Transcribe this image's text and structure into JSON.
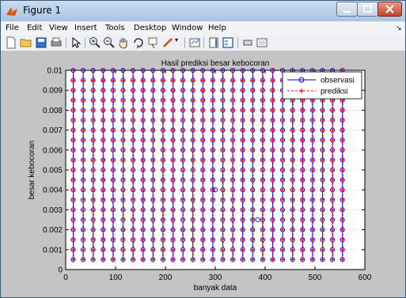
{
  "window": {
    "title": "Figure 1",
    "menu": [
      "File",
      "Edit",
      "View",
      "Insert",
      "Tools",
      "Desktop",
      "Window",
      "Help"
    ],
    "toolbar_icons": [
      "new-file-icon",
      "open-folder-icon",
      "save-icon",
      "print-icon",
      "pointer-icon",
      "zoom-in-icon",
      "zoom-out-icon",
      "pan-hand-icon",
      "rotate-3d-icon",
      "data-cursor-icon",
      "brush-icon",
      "link-plot-icon",
      "colorbar-icon",
      "legend-icon",
      "hide-plot-tools-icon",
      "show-plot-tools-icon"
    ]
  },
  "chart_data": {
    "type": "scatter",
    "title": "Hasil prediksi besar kebocoran",
    "xlabel": "banyak data",
    "ylabel": "besar kebocoran",
    "xlim": [
      0,
      600
    ],
    "ylim": [
      0,
      0.01
    ],
    "xticks": [
      "0",
      "100",
      "200",
      "300",
      "400",
      "500",
      "600"
    ],
    "yticks": [
      "0",
      "0.001",
      "0.002",
      "0.003",
      "0.004",
      "0.005",
      "0.006",
      "0.007",
      "0.008",
      "0.009",
      "0.01"
    ],
    "grid": true,
    "legend_position": "top-right",
    "pattern": {
      "x_start": 15,
      "x_step": 20,
      "x_count": 28,
      "y_start": 0.0005,
      "y_step": 0.0005,
      "y_count": 20
    },
    "series": [
      {
        "name": "observasi",
        "color": "#0000ff",
        "marker": "circle",
        "line": "solid"
      },
      {
        "name": "prediksi",
        "color": "#ff0000",
        "marker": "plus",
        "line": "dashed"
      }
    ],
    "outliers_observasi": [
      [
        300,
        0.004
      ],
      [
        385,
        0.0025
      ]
    ]
  }
}
